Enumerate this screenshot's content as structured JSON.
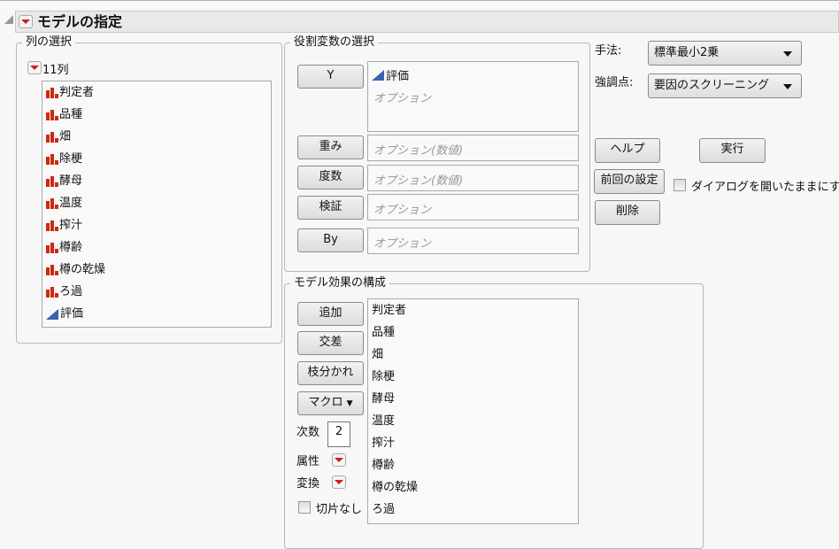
{
  "title": "モデルの指定",
  "columns": {
    "label": "列の選択",
    "count": "11列",
    "items": [
      {
        "name": "判定者",
        "type": "nominal"
      },
      {
        "name": "品種",
        "type": "nominal"
      },
      {
        "name": "畑",
        "type": "nominal"
      },
      {
        "name": "除梗",
        "type": "nominal"
      },
      {
        "name": "酵母",
        "type": "nominal"
      },
      {
        "name": "温度",
        "type": "nominal"
      },
      {
        "name": "搾汁",
        "type": "nominal"
      },
      {
        "name": "樽齢",
        "type": "nominal"
      },
      {
        "name": "樽の乾燥",
        "type": "nominal"
      },
      {
        "name": "ろ過",
        "type": "nominal"
      },
      {
        "name": "評価",
        "type": "continuous"
      }
    ]
  },
  "roles": {
    "label": "役割変数の選択",
    "y_btn": "Y",
    "y_value": "評価",
    "y_placeholder": "オプション",
    "weight_btn": "重み",
    "weight_placeholder": "オプション(数値)",
    "freq_btn": "度数",
    "freq_placeholder": "オプション(数値)",
    "valid_btn": "検証",
    "valid_placeholder": "オプション",
    "by_btn": "By",
    "by_placeholder": "オプション"
  },
  "effects": {
    "label": "モデル効果の構成",
    "add": "追加",
    "cross": "交差",
    "nest": "枝分かれ",
    "macro": "マクロ",
    "degree_label": "次数",
    "degree_value": "2",
    "attr_label": "属性",
    "transform_label": "変換",
    "no_intercept": "切片なし",
    "items": [
      "判定者",
      "品種",
      "畑",
      "除梗",
      "酵母",
      "温度",
      "搾汁",
      "樽齢",
      "樽の乾燥",
      "ろ過"
    ]
  },
  "right": {
    "method_label": "手法:",
    "method_value": "標準最小2乗",
    "emphasis_label": "強調点:",
    "emphasis_value": "要因のスクリーニング",
    "help": "ヘルプ",
    "run": "実行",
    "recall": "前回の設定",
    "keep_open": "ダイアログを開いたままにする",
    "remove": "削除"
  }
}
